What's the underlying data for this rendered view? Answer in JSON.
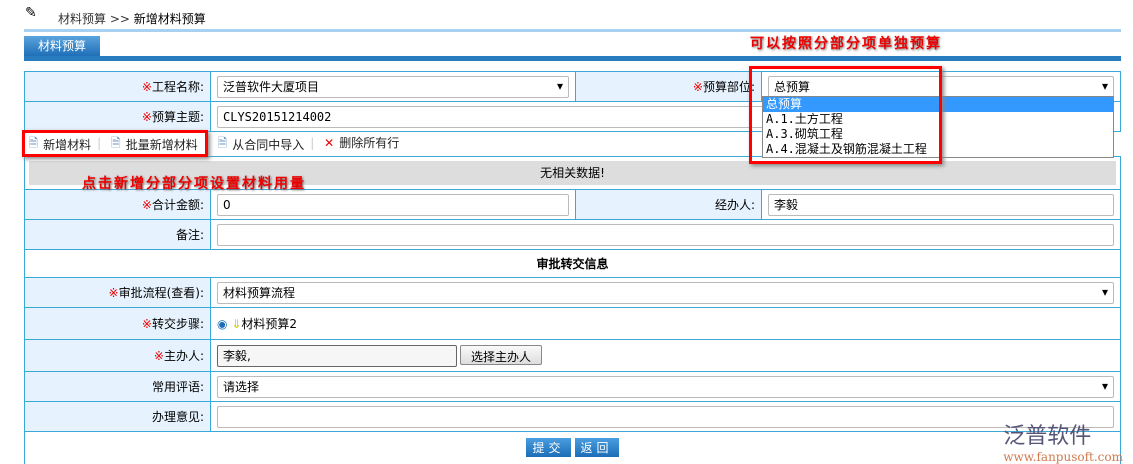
{
  "breadcrumb": {
    "parent": "材料预算",
    "sep": ">>",
    "current": "新增材料预算"
  },
  "tab": "材料预算",
  "annotations": {
    "top": "可以按照分部分项单独预算",
    "left": "点击新增分部分项设置材料用量"
  },
  "form": {
    "project_label": "工程名称:",
    "project_value": "泛普软件大厦项目",
    "part_label": "预算部位:",
    "part_value": "总预算",
    "part_options": [
      "总预算",
      "A.1.土方工程",
      "A.3.砌筑工程",
      "A.4.混凝土及钢筋混凝土工程"
    ],
    "subject_label": "预算主题:",
    "subject_value": "CLYS20151214002",
    "toolbar": [
      "新增材料",
      "批量新增材料",
      "从合同中导入",
      "删除所有行"
    ],
    "nodata": "无相关数据!",
    "total_label": "合计金额:",
    "total_value": "0",
    "handler_label": "经办人:",
    "handler_value": "李毅",
    "remark_label": "备注:",
    "approval_header": "审批转交信息",
    "flow_label": "审批流程",
    "flow_view": "(查看)",
    "flow_value": "材料预算流程",
    "step_label": "转交步骤:",
    "step_value": "材料预算2",
    "host_label": "主办人:",
    "host_value": "李毅,",
    "host_button": "选择主办人",
    "comment_label": "常用评语:",
    "comment_value": "请选择",
    "opinion_label": "办理意见:",
    "submit": "提交",
    "back": "返回",
    "req": "※"
  },
  "logo": {
    "name": "泛普软件",
    "url": "www.fanpusoft.com"
  }
}
